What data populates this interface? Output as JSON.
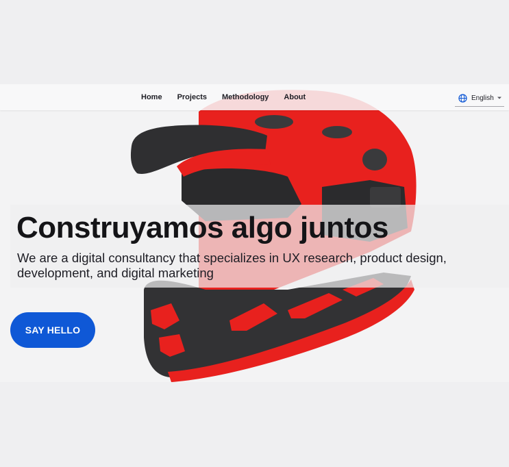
{
  "nav": {
    "links": [
      "Home",
      "Projects",
      "Methodology",
      "About"
    ],
    "language": "English"
  },
  "hero": {
    "title": "Construyamos algo juntos",
    "subtitle": "We are a digital consultancy that specializes in UX research, product design, development, and digital marketing",
    "cta_label": "SAY HELLO"
  },
  "colors": {
    "accent": "#0f58d6",
    "helmet_red": "#e8211e",
    "helmet_black": "#323232"
  },
  "icons": {
    "language": "globe-icon",
    "dropdown": "chevron-down-icon"
  }
}
